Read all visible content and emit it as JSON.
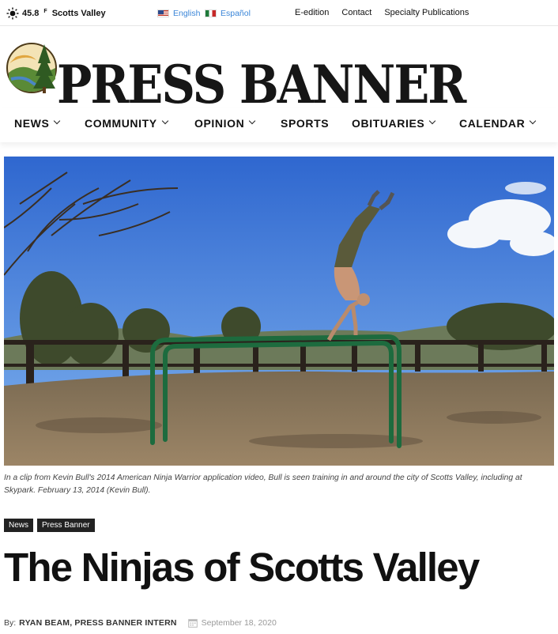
{
  "topbar": {
    "weather": {
      "temperature": "45.8",
      "unit": "F",
      "location": "Scotts Valley",
      "icon": "sun-icon"
    },
    "languages": [
      {
        "label": "English",
        "flag": "us-flag-icon"
      },
      {
        "label": "Español",
        "flag": "mx-flag-icon"
      }
    ],
    "links": [
      "E-edition",
      "Contact",
      "Specialty Publications"
    ]
  },
  "header": {
    "logo_text": "PRESS BANNER"
  },
  "nav": {
    "items": [
      {
        "label": "NEWS",
        "has_dropdown": true
      },
      {
        "label": "COMMUNITY",
        "has_dropdown": true
      },
      {
        "label": "OPINION",
        "has_dropdown": true
      },
      {
        "label": "SPORTS",
        "has_dropdown": false
      },
      {
        "label": "OBITUARIES",
        "has_dropdown": true
      },
      {
        "label": "CALENDAR",
        "has_dropdown": true
      }
    ]
  },
  "article": {
    "image_caption": "In a clip from Kevin Bull's 2014 American Ninja Warrior application video, Bull is seen training in and around the city of Scotts Valley, including at Skypark. February 13, 2014 (Kevin Bull).",
    "tags": [
      "News",
      "Press Banner"
    ],
    "title": "The Ninjas of Scotts Valley",
    "byline_prefix": "By:",
    "author": "RYAN BEAM, PRESS BANNER INTERN",
    "date": "September 18, 2020"
  },
  "colors": {
    "link_blue": "#3b86d8",
    "tag_bg": "#222222",
    "sky": "#3a74d6"
  }
}
